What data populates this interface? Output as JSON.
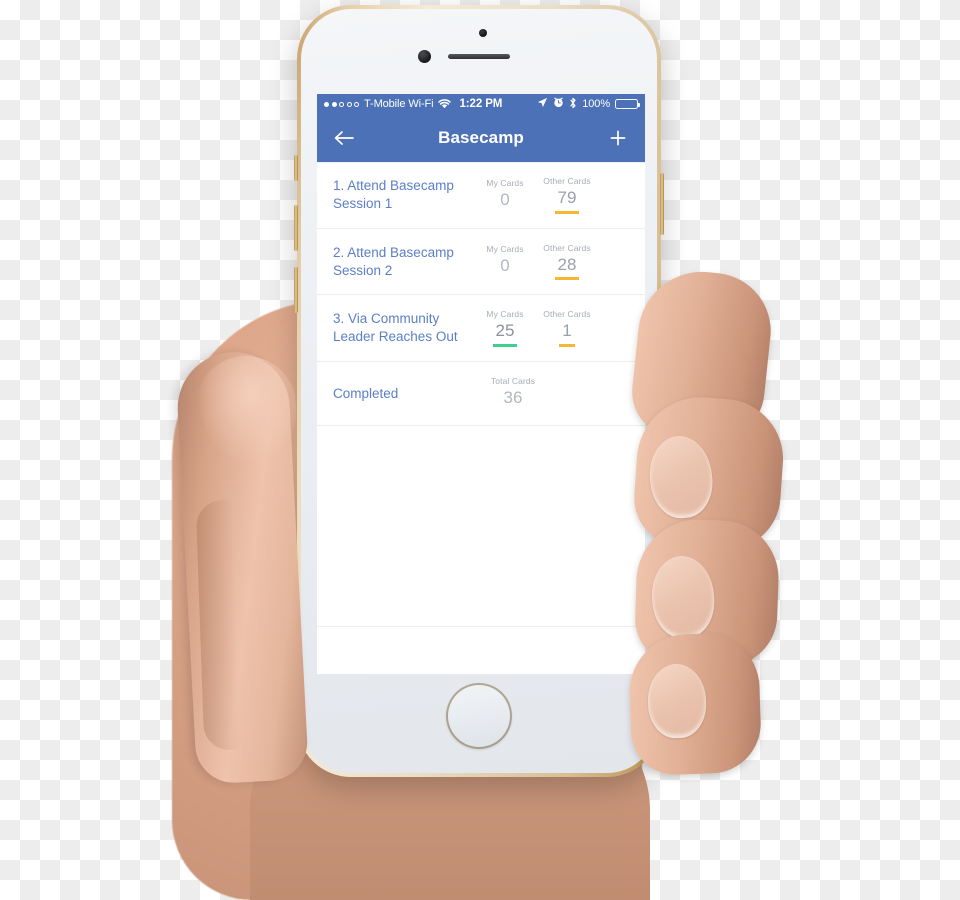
{
  "device": {
    "name": "iPhone",
    "frame_color": "#d8bd92",
    "face_color": "#eceff3"
  },
  "status_bar": {
    "signal_dots_filled": 2,
    "signal_dots_total": 5,
    "carrier": "T-Mobile Wi-Fi",
    "wifi_icon": "wifi-icon",
    "time": "1:22 PM",
    "location_icon": "location-arrow-icon",
    "alarm_icon": "alarm-clock-icon",
    "bluetooth_icon": "bluetooth-icon",
    "battery_percent": "100%",
    "battery_level": 100,
    "background_color": "#4c71b6",
    "text_color": "#ffffff"
  },
  "nav_bar": {
    "back_icon": "back-arrow-icon",
    "title": "Basecamp",
    "add_icon": "plus-icon",
    "background_color": "#4c71b6"
  },
  "list": {
    "rows": [
      {
        "title": "1. Attend Basecamp Session 1",
        "metrics": [
          {
            "label": "My Cards",
            "value": "0",
            "underline": "none"
          },
          {
            "label": "Other Cards",
            "value": "79",
            "underline": "orange"
          }
        ]
      },
      {
        "title": "2. Attend Basecamp Session 2",
        "metrics": [
          {
            "label": "My Cards",
            "value": "0",
            "underline": "none"
          },
          {
            "label": "Other Cards",
            "value": "28",
            "underline": "orange"
          }
        ]
      },
      {
        "title": "3. Via Community Leader Reaches Out",
        "metrics": [
          {
            "label": "My Cards",
            "value": "25",
            "underline": "green"
          },
          {
            "label": "Other Cards",
            "value": "1",
            "underline": "orange"
          }
        ]
      },
      {
        "title": "Completed",
        "metrics": [
          {
            "label": "Total Cards",
            "value": "36",
            "underline": "none"
          }
        ]
      }
    ]
  },
  "colors": {
    "brand_blue": "#4c71b6",
    "title_blue": "#5b7fc7",
    "muted_gray": "#9aa0ab",
    "label_gray": "#a7acb6",
    "accent_orange": "#f7b733",
    "accent_green": "#3ecf8e",
    "divider": "#eceef1",
    "checker_light": "#ffffff",
    "checker_dark": "#ededed"
  }
}
